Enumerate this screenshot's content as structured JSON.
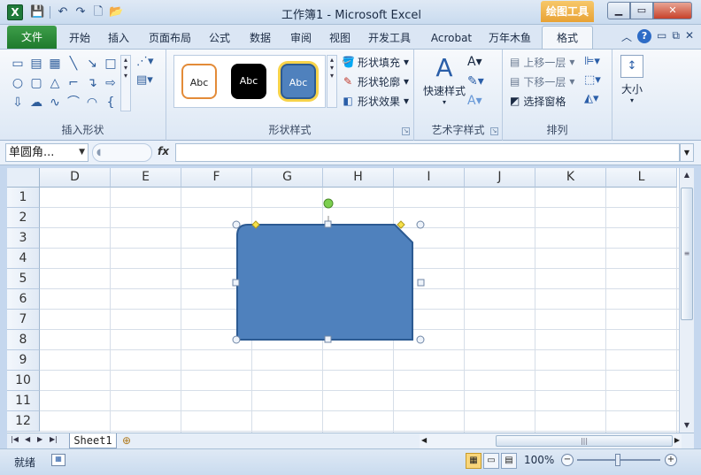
{
  "window": {
    "title": "工作簿1 - Microsoft Excel",
    "app_logo": "X",
    "context_tab_group": "绘图工具",
    "controls": {
      "minimize": "▁",
      "maximize": "▭",
      "close": "✕"
    }
  },
  "qat": {
    "save": "💾",
    "undo": "↶",
    "redo": "↷",
    "new": "🗋",
    "open": "📂"
  },
  "tabs": {
    "file": "文件",
    "items": [
      "开始",
      "插入",
      "页面布局",
      "公式",
      "数据",
      "审阅",
      "视图",
      "开发工具",
      "Acrobat",
      "万年木鱼",
      "格式"
    ],
    "active": "格式"
  },
  "ribbon": {
    "insert_shapes": {
      "label": "插入形状"
    },
    "shape_styles": {
      "label": "形状样式",
      "preset1": "Abc",
      "preset2": "Abc",
      "preset3": "Abc",
      "fill": "形状填充",
      "outline": "形状轮廓",
      "effects": "形状效果"
    },
    "wordart": {
      "label": "艺术字样式",
      "quick_styles": "快速样式"
    },
    "arrange": {
      "label": "排列",
      "bring_forward": "上移一层",
      "send_backward": "下移一层",
      "selection_pane": "选择窗格"
    },
    "size": {
      "label": "大小"
    }
  },
  "formula_bar": {
    "name_box": "单圆角...",
    "fx_label": "fx",
    "formula": ""
  },
  "sheet": {
    "columns": [
      "D",
      "E",
      "F",
      "G",
      "H",
      "I",
      "J",
      "K",
      "L"
    ],
    "rows": [
      "1",
      "2",
      "3",
      "4",
      "5",
      "6",
      "7",
      "8",
      "9",
      "10",
      "11",
      "12"
    ],
    "shape_fill": "#4f81bd",
    "shape_stroke": "#2c5a92"
  },
  "sheet_tabs": {
    "active": "Sheet1"
  },
  "status": {
    "ready": "就绪",
    "zoom": "100%"
  }
}
